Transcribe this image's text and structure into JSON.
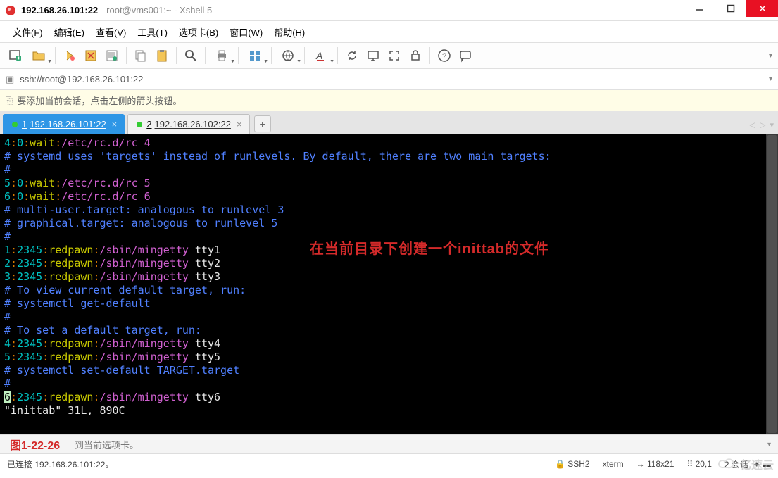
{
  "window": {
    "title": "192.168.26.101:22",
    "subtitle": "root@vms001:~ - Xshell 5"
  },
  "menu": [
    "文件(F)",
    "编辑(E)",
    "查看(V)",
    "工具(T)",
    "选项卡(B)",
    "窗口(W)",
    "帮助(H)"
  ],
  "toolbar_icons": [
    "new-session-icon",
    "open-icon",
    "",
    "reconnect-icon",
    "disconnect-icon",
    "properties-icon",
    "",
    "copy-icon",
    "paste-icon",
    "",
    "search-icon",
    "",
    "print-icon",
    "",
    "layout-icon",
    "",
    "globe-icon",
    "",
    "font-icon",
    "",
    "sync-icon",
    "lock-screen-icon",
    "fullscreen-icon",
    "key-icon",
    "",
    "help-icon",
    "chat-icon"
  ],
  "addressbar": {
    "text": "ssh://root@192.168.26.101:22"
  },
  "hint": {
    "text": "要添加当前会话，点击左侧的箭头按钮。"
  },
  "tabs": {
    "items": [
      {
        "num": "1",
        "label": "192.168.26.101:22",
        "active": true
      },
      {
        "num": "2",
        "label": "192.168.26.102:22",
        "active": false
      }
    ]
  },
  "terminal": {
    "lines": [
      {
        "segs": [
          {
            "t": "4",
            "c": "c-cyan"
          },
          {
            "t": ":",
            "c": "c-orange"
          },
          {
            "t": "0",
            "c": "c-cyan"
          },
          {
            "t": ":",
            "c": "c-orange"
          },
          {
            "t": "wait",
            "c": "c-yellow"
          },
          {
            "t": ":",
            "c": "c-orange"
          },
          {
            "t": "/etc/rc.d/rc 4",
            "c": "c-magenta"
          }
        ]
      },
      {
        "segs": [
          {
            "t": "# systemd uses 'targets' instead of runlevels. By default, there are two main targets:",
            "c": "c-blue"
          }
        ]
      },
      {
        "segs": [
          {
            "t": "#",
            "c": "c-blue"
          }
        ]
      },
      {
        "segs": [
          {
            "t": "5",
            "c": "c-cyan"
          },
          {
            "t": ":",
            "c": "c-orange"
          },
          {
            "t": "0",
            "c": "c-cyan"
          },
          {
            "t": ":",
            "c": "c-orange"
          },
          {
            "t": "wait",
            "c": "c-yellow"
          },
          {
            "t": ":",
            "c": "c-orange"
          },
          {
            "t": "/etc/rc.d/rc 5",
            "c": "c-magenta"
          }
        ]
      },
      {
        "segs": [
          {
            "t": "6",
            "c": "c-cyan"
          },
          {
            "t": ":",
            "c": "c-orange"
          },
          {
            "t": "0",
            "c": "c-cyan"
          },
          {
            "t": ":",
            "c": "c-orange"
          },
          {
            "t": "wait",
            "c": "c-yellow"
          },
          {
            "t": ":",
            "c": "c-orange"
          },
          {
            "t": "/etc/rc.d/rc 6",
            "c": "c-magenta"
          }
        ]
      },
      {
        "segs": [
          {
            "t": "# multi-user.target: analogous to runlevel 3",
            "c": "c-blue"
          }
        ]
      },
      {
        "segs": [
          {
            "t": "# graphical.target: analogous to runlevel 5",
            "c": "c-blue"
          }
        ]
      },
      {
        "segs": [
          {
            "t": "#",
            "c": "c-blue"
          }
        ]
      },
      {
        "segs": [
          {
            "t": "1",
            "c": "c-cyan"
          },
          {
            "t": ":",
            "c": "c-orange"
          },
          {
            "t": "2345",
            "c": "c-cyan"
          },
          {
            "t": ":",
            "c": "c-orange"
          },
          {
            "t": "redpawn",
            "c": "c-yellow"
          },
          {
            "t": ":",
            "c": "c-orange"
          },
          {
            "t": "/sbin/mingetty",
            "c": "c-magenta"
          },
          {
            "t": " tty1",
            "c": "c-white"
          }
        ]
      },
      {
        "segs": [
          {
            "t": "2",
            "c": "c-cyan"
          },
          {
            "t": ":",
            "c": "c-orange"
          },
          {
            "t": "2345",
            "c": "c-cyan"
          },
          {
            "t": ":",
            "c": "c-orange"
          },
          {
            "t": "redpawn",
            "c": "c-yellow"
          },
          {
            "t": ":",
            "c": "c-orange"
          },
          {
            "t": "/sbin/mingetty",
            "c": "c-magenta"
          },
          {
            "t": " tty2",
            "c": "c-white"
          }
        ]
      },
      {
        "segs": [
          {
            "t": "3",
            "c": "c-cyan"
          },
          {
            "t": ":",
            "c": "c-orange"
          },
          {
            "t": "2345",
            "c": "c-cyan"
          },
          {
            "t": ":",
            "c": "c-orange"
          },
          {
            "t": "redpawn",
            "c": "c-yellow"
          },
          {
            "t": ":",
            "c": "c-orange"
          },
          {
            "t": "/sbin/mingetty",
            "c": "c-magenta"
          },
          {
            "t": " tty3",
            "c": "c-white"
          }
        ]
      },
      {
        "segs": [
          {
            "t": "# To view current default target, run:",
            "c": "c-blue"
          }
        ]
      },
      {
        "segs": [
          {
            "t": "# systemctl get-default",
            "c": "c-blue"
          }
        ]
      },
      {
        "segs": [
          {
            "t": "#",
            "c": "c-blue"
          }
        ]
      },
      {
        "segs": [
          {
            "t": "# To set a default target, run:",
            "c": "c-blue"
          }
        ]
      },
      {
        "segs": [
          {
            "t": "4",
            "c": "c-cyan"
          },
          {
            "t": ":",
            "c": "c-orange"
          },
          {
            "t": "2345",
            "c": "c-cyan"
          },
          {
            "t": ":",
            "c": "c-orange"
          },
          {
            "t": "redpawn",
            "c": "c-yellow"
          },
          {
            "t": ":",
            "c": "c-orange"
          },
          {
            "t": "/sbin/mingetty",
            "c": "c-magenta"
          },
          {
            "t": " tty4",
            "c": "c-white"
          }
        ]
      },
      {
        "segs": [
          {
            "t": "5",
            "c": "c-cyan"
          },
          {
            "t": ":",
            "c": "c-orange"
          },
          {
            "t": "2345",
            "c": "c-cyan"
          },
          {
            "t": ":",
            "c": "c-orange"
          },
          {
            "t": "redpawn",
            "c": "c-yellow"
          },
          {
            "t": ":",
            "c": "c-orange"
          },
          {
            "t": "/sbin/mingetty",
            "c": "c-magenta"
          },
          {
            "t": " tty5",
            "c": "c-white"
          }
        ]
      },
      {
        "segs": [
          {
            "t": "# systemctl set-default TARGET.target",
            "c": "c-blue"
          }
        ]
      },
      {
        "segs": [
          {
            "t": "#",
            "c": "c-blue"
          }
        ]
      },
      {
        "segs": [
          {
            "t": "6",
            "c": "cursor-box"
          },
          {
            "t": ":",
            "c": "c-orange"
          },
          {
            "t": "2345",
            "c": "c-cyan"
          },
          {
            "t": ":",
            "c": "c-orange"
          },
          {
            "t": "redpawn",
            "c": "c-yellow"
          },
          {
            "t": ":",
            "c": "c-orange"
          },
          {
            "t": "/sbin/mingetty",
            "c": "c-magenta"
          },
          {
            "t": " tty6",
            "c": "c-white"
          }
        ]
      },
      {
        "segs": [
          {
            "t": "\"inittab\" 31L, 890C",
            "c": "c-white"
          }
        ]
      }
    ],
    "annotation": "在当前目录下创建一个inittab的文件"
  },
  "footer": {
    "figure_label": "图1-22-26",
    "hint_text": "到当前选项卡。"
  },
  "status": {
    "left": "已连接 192.168.26.101:22。",
    "ssh": "SSH2",
    "term": "xterm",
    "size": "118x21",
    "cursor": "20,1",
    "sessions": "2 会话"
  },
  "watermark": "亿速云"
}
